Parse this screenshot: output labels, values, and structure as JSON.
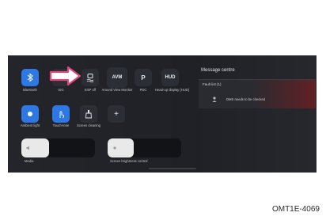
{
  "quick_controls": [
    {
      "label": "Bluetooth",
      "icon": "bluetooth-icon",
      "active": true
    },
    {
      "label": "ISG",
      "icon": "isg-icon",
      "active": false
    },
    {
      "label": "ESP off",
      "icon": "esp-off-icon",
      "active": false
    },
    {
      "label": "Around View Monitor",
      "icon": "avm-icon",
      "active": false,
      "tile_text": "AVM"
    },
    {
      "label": "PDC",
      "icon": "pdc-icon",
      "active": false,
      "tile_text": "P"
    },
    {
      "label": "Head-up display (HUD)",
      "icon": "hud-icon",
      "active": false,
      "tile_text": "HUD"
    },
    {
      "label": "Ambient light",
      "icon": "ambient-light-icon",
      "active": true
    },
    {
      "label": "Touch-tone",
      "icon": "touch-icon",
      "active": true
    },
    {
      "label": "Screen cleaning",
      "icon": "screen-cleaning-icon",
      "active": false
    },
    {
      "label": "",
      "icon": "add-icon",
      "active": false,
      "tile_text": "+"
    }
  ],
  "sliders": {
    "media": {
      "label": "Media",
      "level": 0.38
    },
    "brightness": {
      "label": "Screen brightness control",
      "level": 0.35
    }
  },
  "message_centre": {
    "title": "Message centre",
    "fault_list": "Fault list (1)",
    "fault_text": "DMS needs to be checked"
  },
  "figure_id": "OMT1E-4069",
  "colors": {
    "accent_blue": "#2e78e6",
    "panel_bg": "#1f2126",
    "fault_red": "#911818"
  }
}
